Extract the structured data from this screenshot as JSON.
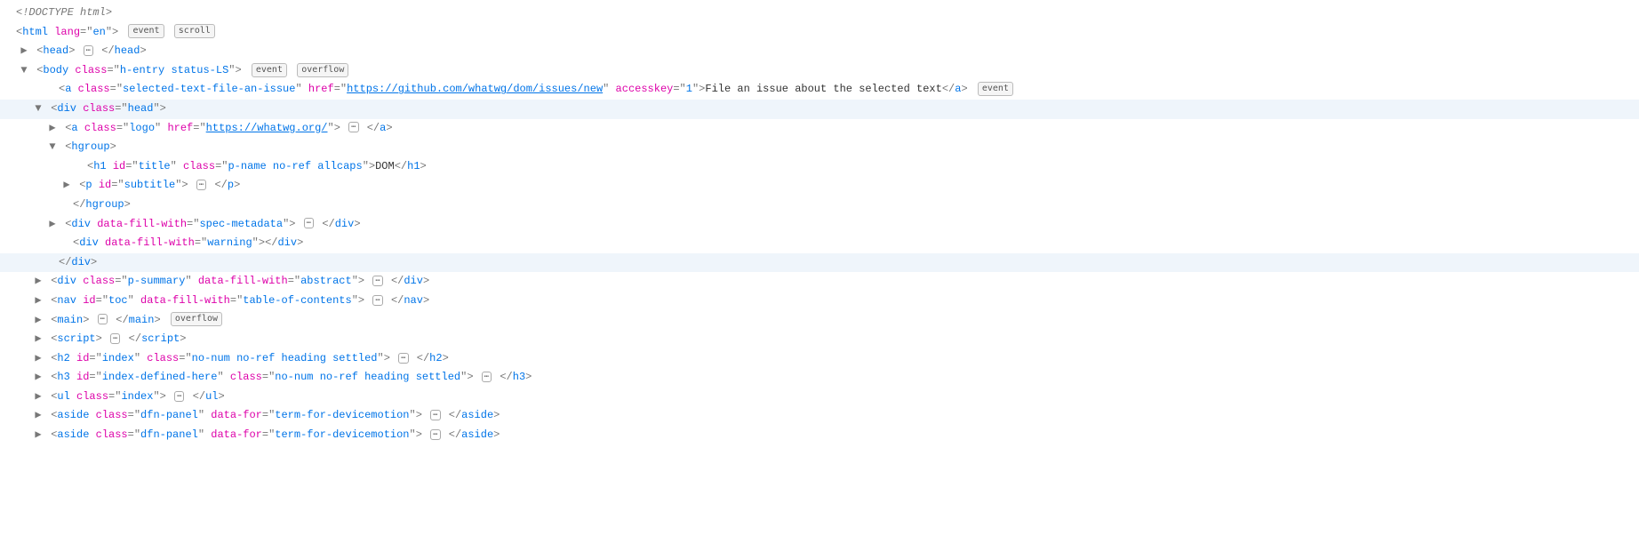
{
  "doctype": "<!DOCTYPE html>",
  "badges": {
    "event": "event",
    "scroll": "scroll",
    "overflow": "overflow"
  },
  "lines": {
    "html_open": {
      "tag": "html",
      "attrs": [
        {
          "n": "lang",
          "v": "en"
        }
      ]
    },
    "head": {
      "tag": "head"
    },
    "body_open": {
      "tag": "body",
      "attrs": [
        {
          "n": "class",
          "v": "h-entry status-LS"
        }
      ]
    },
    "a_issue": {
      "tag": "a",
      "attrs": [
        {
          "n": "class",
          "v": "selected-text-file-an-issue"
        },
        {
          "n": "href",
          "v": "https://github.com/whatwg/dom/issues/new",
          "link": true
        },
        {
          "n": "accesskey",
          "v": "1"
        }
      ],
      "text": "File an issue about the selected text"
    },
    "div_head_open": {
      "tag": "div",
      "attrs": [
        {
          "n": "class",
          "v": "head"
        }
      ]
    },
    "a_logo": {
      "tag": "a",
      "attrs": [
        {
          "n": "class",
          "v": "logo"
        },
        {
          "n": "href",
          "v": "https://whatwg.org/",
          "link": true
        }
      ]
    },
    "hgroup_open": {
      "tag": "hgroup"
    },
    "h1_title": {
      "tag": "h1",
      "attrs": [
        {
          "n": "id",
          "v": "title"
        },
        {
          "n": "class",
          "v": "p-name no-ref allcaps"
        }
      ],
      "text": "DOM"
    },
    "p_subtitle": {
      "tag": "p",
      "attrs": [
        {
          "n": "id",
          "v": "subtitle"
        }
      ]
    },
    "hgroup_close": {
      "tag": "hgroup"
    },
    "div_spec_meta": {
      "tag": "div",
      "attrs": [
        {
          "n": "data-fill-with",
          "v": "spec-metadata"
        }
      ]
    },
    "div_warning": {
      "tag": "div",
      "attrs": [
        {
          "n": "data-fill-with",
          "v": "warning"
        }
      ]
    },
    "div_head_close": {
      "tag": "div"
    },
    "div_summary": {
      "tag": "div",
      "attrs": [
        {
          "n": "class",
          "v": "p-summary"
        },
        {
          "n": "data-fill-with",
          "v": "abstract"
        }
      ]
    },
    "nav_toc": {
      "tag": "nav",
      "attrs": [
        {
          "n": "id",
          "v": "toc"
        },
        {
          "n": "data-fill-with",
          "v": "table-of-contents"
        }
      ]
    },
    "main": {
      "tag": "main"
    },
    "script": {
      "tag": "script"
    },
    "h2_index": {
      "tag": "h2",
      "attrs": [
        {
          "n": "id",
          "v": "index"
        },
        {
          "n": "class",
          "v": "no-num no-ref heading settled"
        }
      ]
    },
    "h3_index_def": {
      "tag": "h3",
      "attrs": [
        {
          "n": "id",
          "v": "index-defined-here"
        },
        {
          "n": "class",
          "v": "no-num no-ref heading settled"
        }
      ]
    },
    "ul_index": {
      "tag": "ul",
      "attrs": [
        {
          "n": "class",
          "v": "index"
        }
      ]
    },
    "aside1": {
      "tag": "aside",
      "attrs": [
        {
          "n": "class",
          "v": "dfn-panel"
        },
        {
          "n": "data-for",
          "v": "term-for-devicemotion"
        }
      ]
    },
    "aside2": {
      "tag": "aside",
      "attrs": [
        {
          "n": "class",
          "v": "dfn-panel"
        },
        {
          "n": "data-for",
          "v": "term-for-devicemotion"
        }
      ]
    }
  }
}
